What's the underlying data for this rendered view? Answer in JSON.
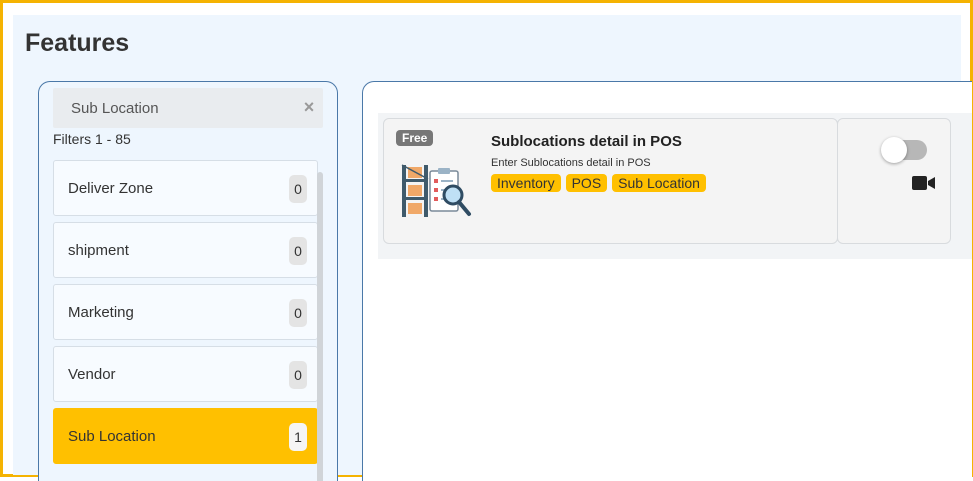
{
  "page": {
    "title": "Features"
  },
  "search": {
    "value": "Sub Location",
    "clear_icon": "×"
  },
  "filters": {
    "count_text": "Filters 1 - 85",
    "items": [
      {
        "label": "Deliver Zone",
        "count": "0",
        "active": false
      },
      {
        "label": "shipment",
        "count": "0",
        "active": false
      },
      {
        "label": "Marketing",
        "count": "0",
        "active": false
      },
      {
        "label": "Vendor",
        "count": "0",
        "active": false
      },
      {
        "label": "Sub Location",
        "count": "1",
        "active": true
      }
    ]
  },
  "feature_card": {
    "badge": "Free",
    "title": "Sublocations detail in POS",
    "description": "Enter Sublocations detail in POS",
    "tags": [
      "Inventory",
      "POS",
      "Sub Location"
    ],
    "toggle_on": false,
    "video_icon": "video-camera-icon"
  },
  "colors": {
    "accent": "#ffc000",
    "frame_border": "#f5b301",
    "panel_border": "#4a78a8",
    "panel_bg": "#eef6fe"
  }
}
